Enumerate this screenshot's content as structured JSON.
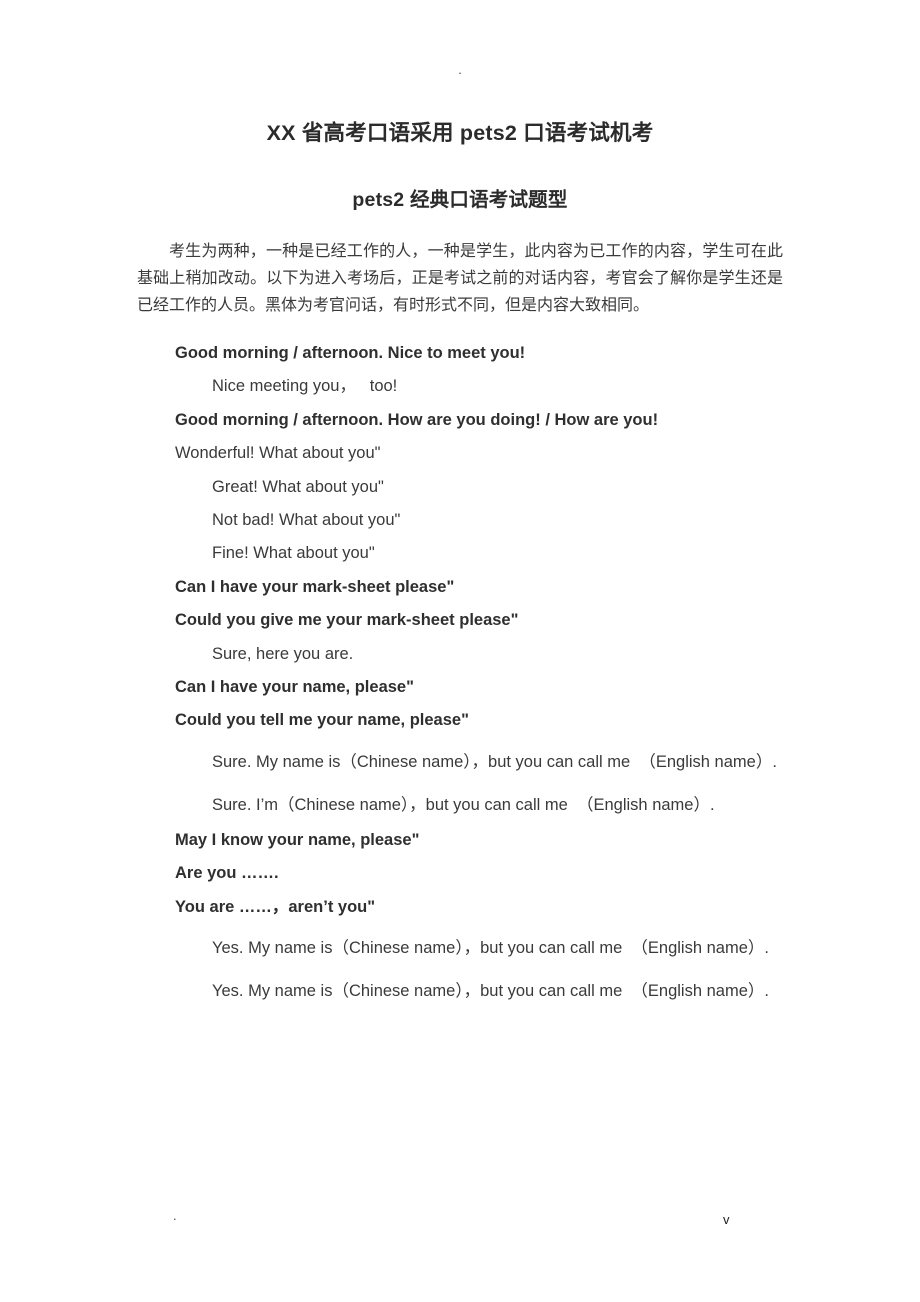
{
  "page": {
    "header_mark": ".",
    "footer_mark_left": ".",
    "footer_mark_right": "v",
    "background_color": "#ffffff",
    "text_color": "#3a3a3a",
    "heading_color": "#2b2b2b"
  },
  "document": {
    "title": "XX 省高考口语采用 pets2 口语考试机考",
    "subtitle": "pets2 经典口语考试题型",
    "intro": "考生为两种，一种是已经工作的人，一种是学生，此内容为已工作的内容，学生可在此基础上稍加改动。以下为进入考场后，正是考试之前的对话内容，考官会了解你是学生还是已经工作的人员。黑体为考官问话，有时形式不同，但是内容大致相同。"
  },
  "dialogue": {
    "lines": [
      {
        "role": "examiner",
        "style": "q",
        "text": "Good morning / afternoon. Nice to meet you!"
      },
      {
        "role": "candidate",
        "style": "a",
        "text": "Nice meeting you，   too!"
      },
      {
        "role": "examiner",
        "style": "q",
        "text": "Good morning / afternoon. How are you doing! / How are you!"
      },
      {
        "role": "candidate",
        "style": "plain",
        "text": "Wonderful! What about you\""
      },
      {
        "role": "candidate",
        "style": "a",
        "text": "Great! What about you\""
      },
      {
        "role": "candidate",
        "style": "a",
        "text": "Not bad! What about you\""
      },
      {
        "role": "candidate",
        "style": "a",
        "text": "Fine! What about you\""
      },
      {
        "role": "examiner",
        "style": "q",
        "text": "Can I have your mark-sheet please\""
      },
      {
        "role": "examiner",
        "style": "q",
        "text": "Could you give me your mark-sheet please\""
      },
      {
        "role": "candidate",
        "style": "a",
        "text": "Sure, here you are."
      },
      {
        "role": "examiner",
        "style": "q",
        "text": "Can I have your name, please\""
      },
      {
        "role": "examiner",
        "style": "q",
        "text": "Could you tell me your name, please\""
      },
      {
        "role": "candidate",
        "style": "a-wrap",
        "text": "Sure. My name is（Chinese name），but you can call me  （English name）."
      },
      {
        "role": "candidate",
        "style": "a-wrap",
        "text": "Sure. I’m（Chinese name），but you can call me  （English name）."
      },
      {
        "role": "examiner",
        "style": "q",
        "text": "May I know your name, please\""
      },
      {
        "role": "examiner",
        "style": "q",
        "text": "Are you ……."
      },
      {
        "role": "examiner",
        "style": "q",
        "text": "You are ……，aren’t you\""
      },
      {
        "role": "candidate",
        "style": "a-wrap",
        "text": "Yes. My name is（Chinese name），but you can call me  （English name）."
      },
      {
        "role": "candidate",
        "style": "a-wrap",
        "text": "Yes. My name is（Chinese name），but you can call me  （English name）."
      }
    ]
  }
}
